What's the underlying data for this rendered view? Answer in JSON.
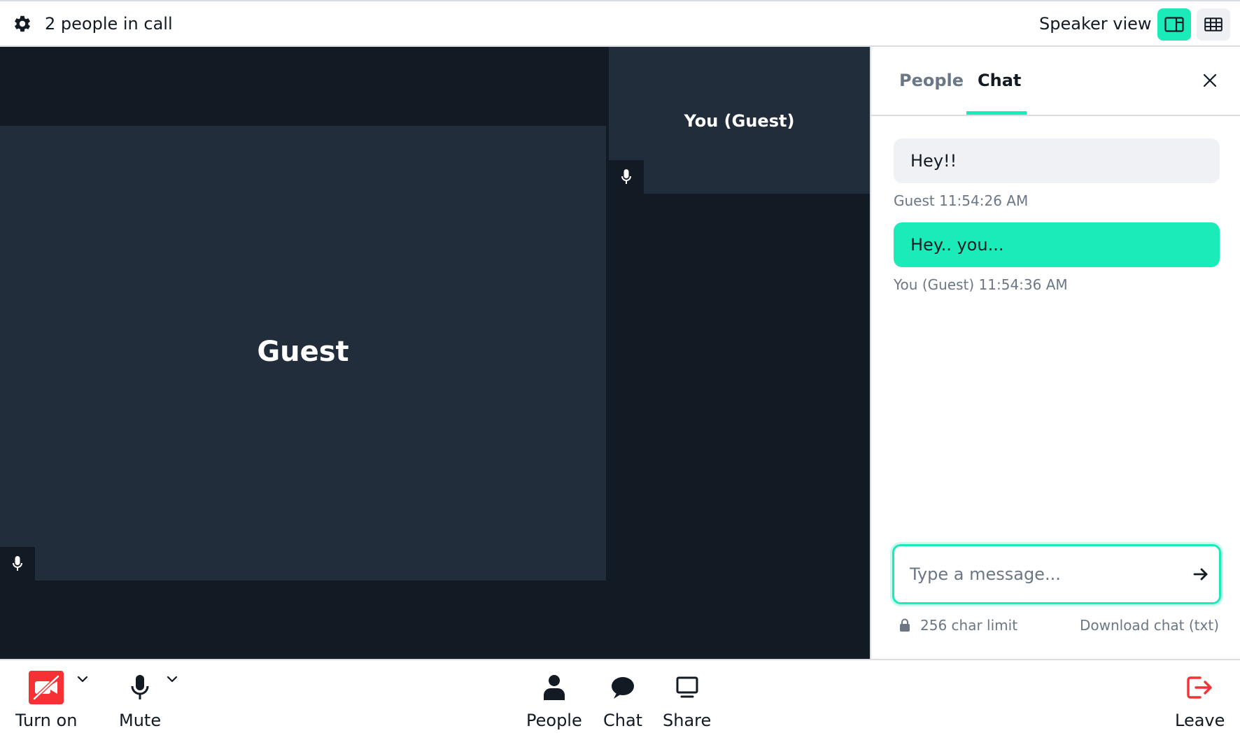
{
  "topbar": {
    "people_count": "2 people in call",
    "view_label": "Speaker view",
    "icons": {
      "settings": "gear-icon",
      "speaker_view": "speaker-view-icon",
      "grid_view": "grid-view-icon"
    }
  },
  "video": {
    "main_tile_name": "Guest",
    "side_tile_name": "You (Guest)"
  },
  "panel": {
    "tabs": [
      {
        "label": "People"
      },
      {
        "label": "Chat"
      }
    ],
    "active_tab": "Chat",
    "messages": [
      {
        "text": "Hey!!",
        "meta": "Guest 11:54:26 AM"
      },
      {
        "text": "Hey.. you...",
        "meta": "You (Guest) 11:54:36 AM"
      }
    ],
    "composer_placeholder": "Type a message...",
    "composer_value": "",
    "char_limit": "256 char limit",
    "download_label": "Download chat (txt)"
  },
  "bottombar": {
    "camera_label": "Turn on",
    "mic_label": "Mute",
    "people_label": "People",
    "chat_label": "Chat",
    "share_label": "Share",
    "leave_label": "Leave"
  },
  "colors": {
    "accent": "#1bebb9",
    "danger": "#f63135",
    "video_bg": "#121a24",
    "tile_bg": "#222d3c",
    "text": "#121a24",
    "muted": "#6b7785"
  }
}
